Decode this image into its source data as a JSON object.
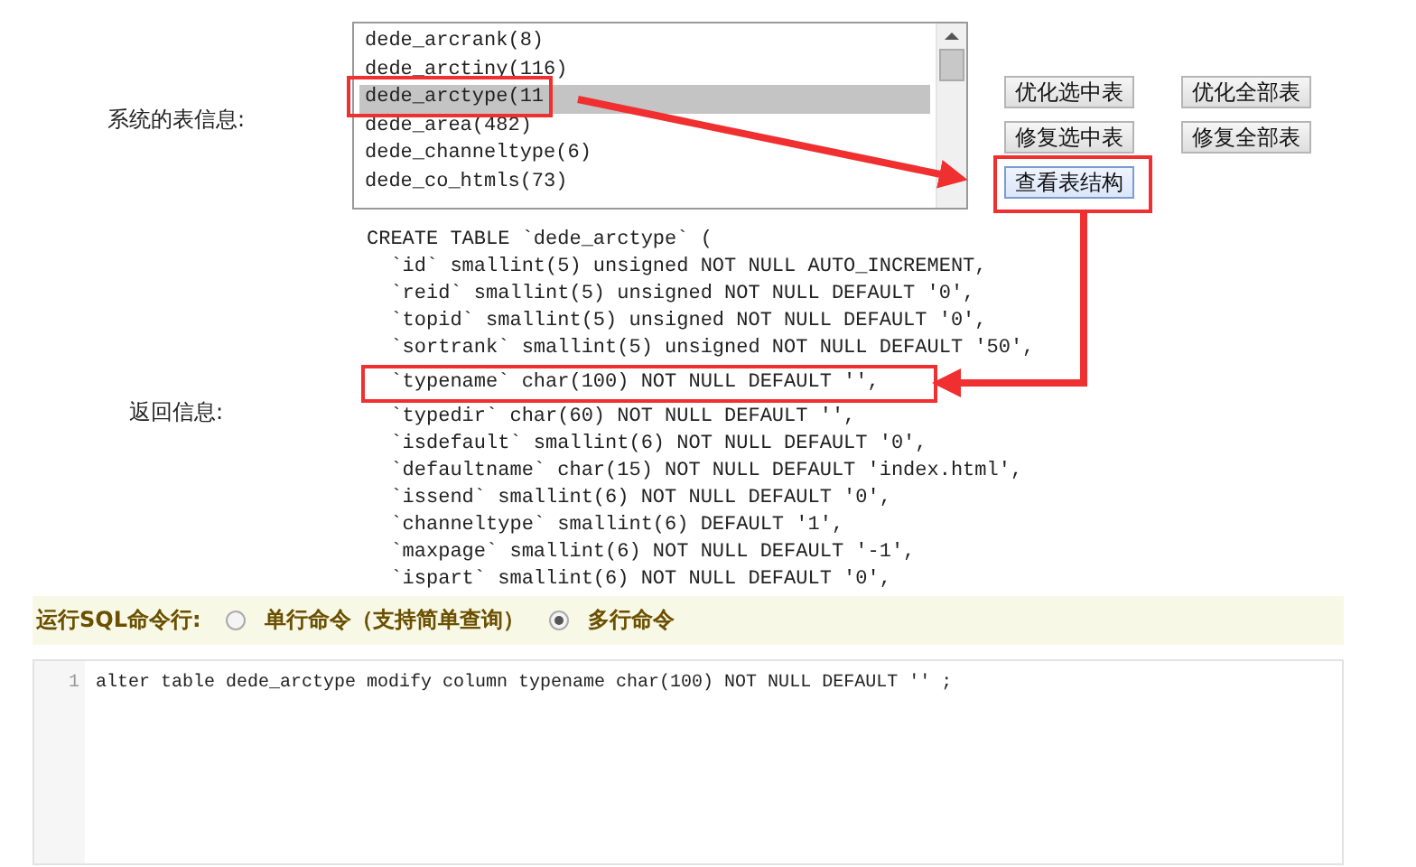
{
  "table_info": {
    "label": "系统的表信息:",
    "tables": [
      {
        "name": "dede_arcrank(8)",
        "selected": false
      },
      {
        "name": "dede_arctiny(116)",
        "selected": false
      },
      {
        "name": "dede_arctype(11",
        "selected": true
      },
      {
        "name": "dede_area(482)",
        "selected": false
      },
      {
        "name": "dede_channeltype(6)",
        "selected": false
      },
      {
        "name": "dede_co_htmls(73)",
        "selected": false
      }
    ],
    "buttons": [
      "优化选中表",
      "优化全部表",
      "修复选中表",
      "修复全部表",
      "查看表结构"
    ]
  },
  "return_info": {
    "label": "返回信息:",
    "lines": [
      "CREATE TABLE `dede_arctype` (",
      "  `id` smallint(5) unsigned NOT NULL AUTO_INCREMENT,",
      "  `reid` smallint(5) unsigned NOT NULL DEFAULT '0',",
      "  `topid` smallint(5) unsigned NOT NULL DEFAULT '0',",
      "  `sortrank` smallint(5) unsigned NOT NULL DEFAULT '50',",
      "  `typename` char(100) NOT NULL DEFAULT '',",
      "  `typedir` char(60) NOT NULL DEFAULT '',",
      "  `isdefault` smallint(6) NOT NULL DEFAULT '0',",
      "  `defaultname` char(15) NOT NULL DEFAULT 'index.html',",
      "  `issend` smallint(6) NOT NULL DEFAULT '0',",
      "  `channeltype` smallint(6) DEFAULT '1',",
      "  `maxpage` smallint(6) NOT NULL DEFAULT '-1',",
      "  `ispart` smallint(6) NOT NULL DEFAULT '0',"
    ]
  },
  "sql": {
    "label": "运行SQL命令行:",
    "modes": [
      {
        "label": "单行命令（支持简单查询）",
        "selected": false
      },
      {
        "label": "多行命令",
        "selected": true
      }
    ],
    "editor": {
      "line_numbers": [
        "1"
      ],
      "lines": [
        "alter table dede_arctype modify column typename char(100) NOT NULL DEFAULT '' ;"
      ]
    }
  }
}
